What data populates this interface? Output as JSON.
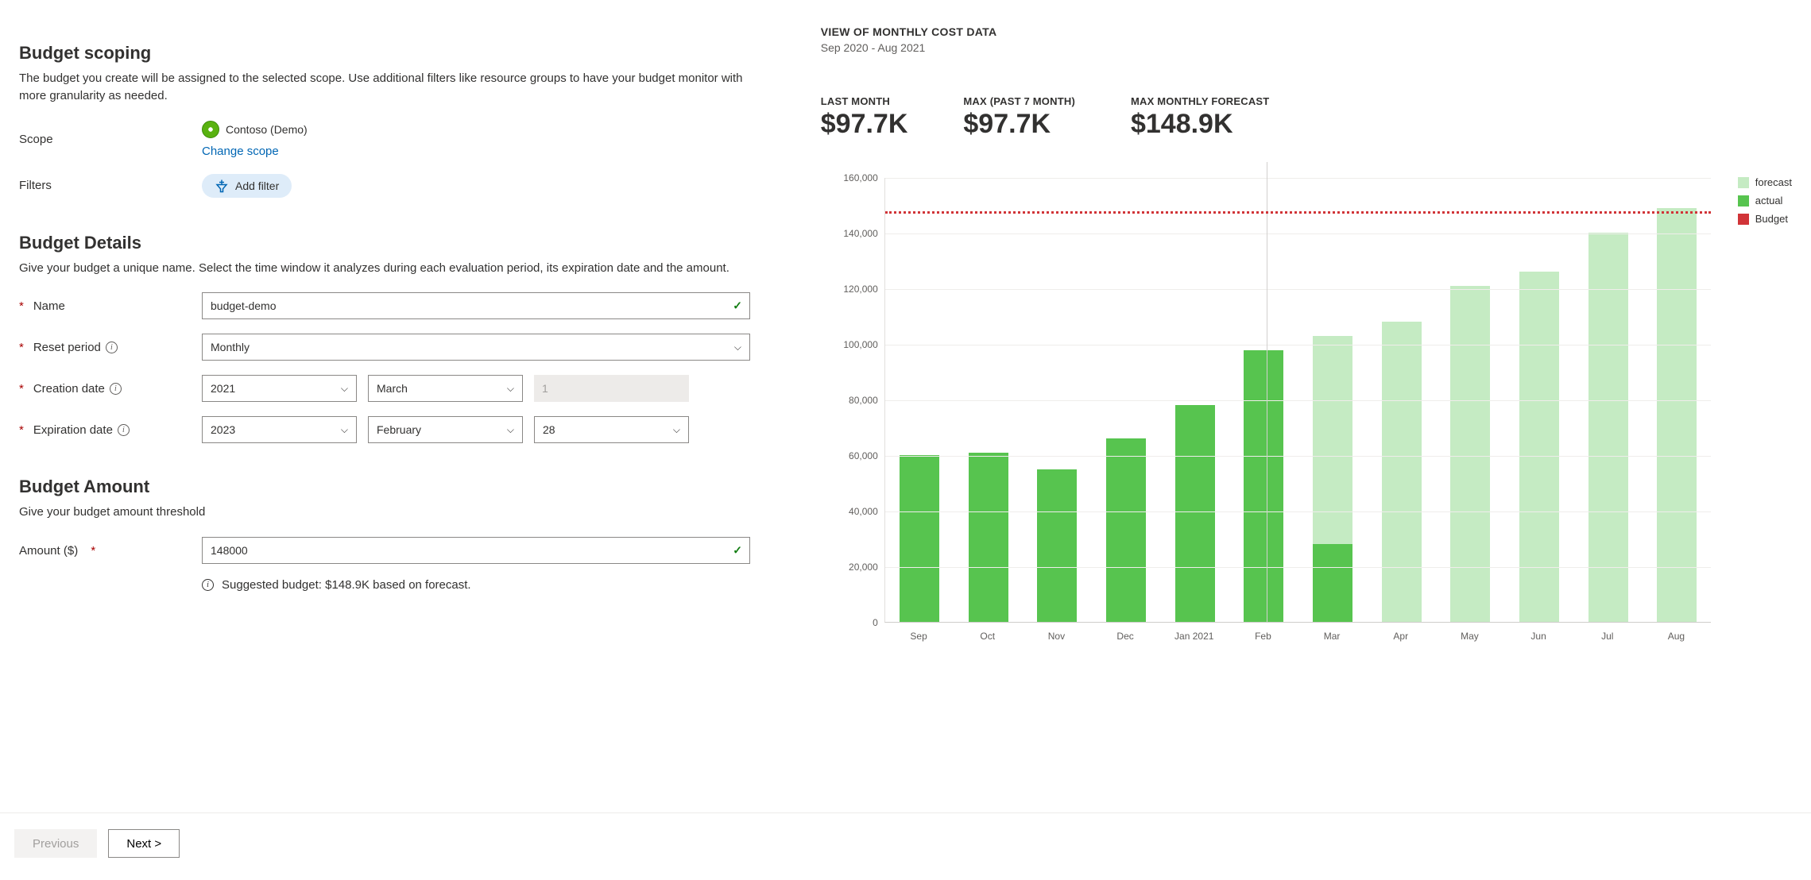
{
  "scoping": {
    "title": "Budget scoping",
    "desc": "The budget you create will be assigned to the selected scope. Use additional filters like resource groups to have your budget monitor with more granularity as needed.",
    "scope_label": "Scope",
    "scope_value": "Contoso (Demo)",
    "change_scope": "Change scope",
    "filters_label": "Filters",
    "add_filter": "Add filter"
  },
  "details": {
    "title": "Budget Details",
    "desc": "Give your budget a unique name. Select the time window it analyzes during each evaluation period, its expiration date and the amount.",
    "name_label": "Name",
    "name_value": "budget-demo",
    "reset_label": "Reset period",
    "reset_value": "Monthly",
    "creation_label": "Creation date",
    "creation_year": "2021",
    "creation_month": "March",
    "creation_day": "1",
    "expiration_label": "Expiration date",
    "expiration_year": "2023",
    "expiration_month": "February",
    "expiration_day": "28"
  },
  "amount": {
    "title": "Budget Amount",
    "desc": "Give your budget amount threshold",
    "label": "Amount ($)",
    "value": "148000",
    "suggested": "Suggested budget: $148.9K based on forecast."
  },
  "view": {
    "title": "VIEW OF MONTHLY COST DATA",
    "range": "Sep 2020 - Aug 2021"
  },
  "stats": {
    "last_month_label": "LAST MONTH",
    "last_month_value": "$97.7K",
    "max_label": "MAX (PAST 7 MONTH)",
    "max_value": "$97.7K",
    "forecast_label": "MAX MONTHLY FORECAST",
    "forecast_value": "$148.9K"
  },
  "legend": {
    "forecast": "forecast",
    "actual": "actual",
    "budget": "Budget"
  },
  "footer": {
    "previous": "Previous",
    "next": "Next >"
  },
  "chart_data": {
    "type": "bar",
    "title": "View of monthly cost data",
    "xlabel": "",
    "ylabel": "",
    "ylim": [
      0,
      160000
    ],
    "y_ticks": [
      0,
      20000,
      40000,
      60000,
      80000,
      100000,
      120000,
      140000,
      160000
    ],
    "y_tick_labels": [
      "0",
      "20,000",
      "40,000",
      "60,000",
      "80,000",
      "100,000",
      "120,000",
      "140,000",
      "160,000"
    ],
    "categories": [
      "Sep",
      "Oct",
      "Nov",
      "Dec",
      "Jan 2021",
      "Feb",
      "Mar",
      "Apr",
      "May",
      "Jun",
      "Jul",
      "Aug"
    ],
    "series": [
      {
        "name": "actual",
        "color": "#57c44f",
        "values": [
          60000,
          61000,
          55000,
          66000,
          78000,
          97700,
          28000,
          null,
          null,
          null,
          null,
          null
        ]
      },
      {
        "name": "forecast",
        "color": "#c5ebc3",
        "values": [
          null,
          null,
          null,
          null,
          null,
          null,
          103000,
          108000,
          121000,
          126000,
          140000,
          148900
        ]
      }
    ],
    "budget_line": 148000
  }
}
